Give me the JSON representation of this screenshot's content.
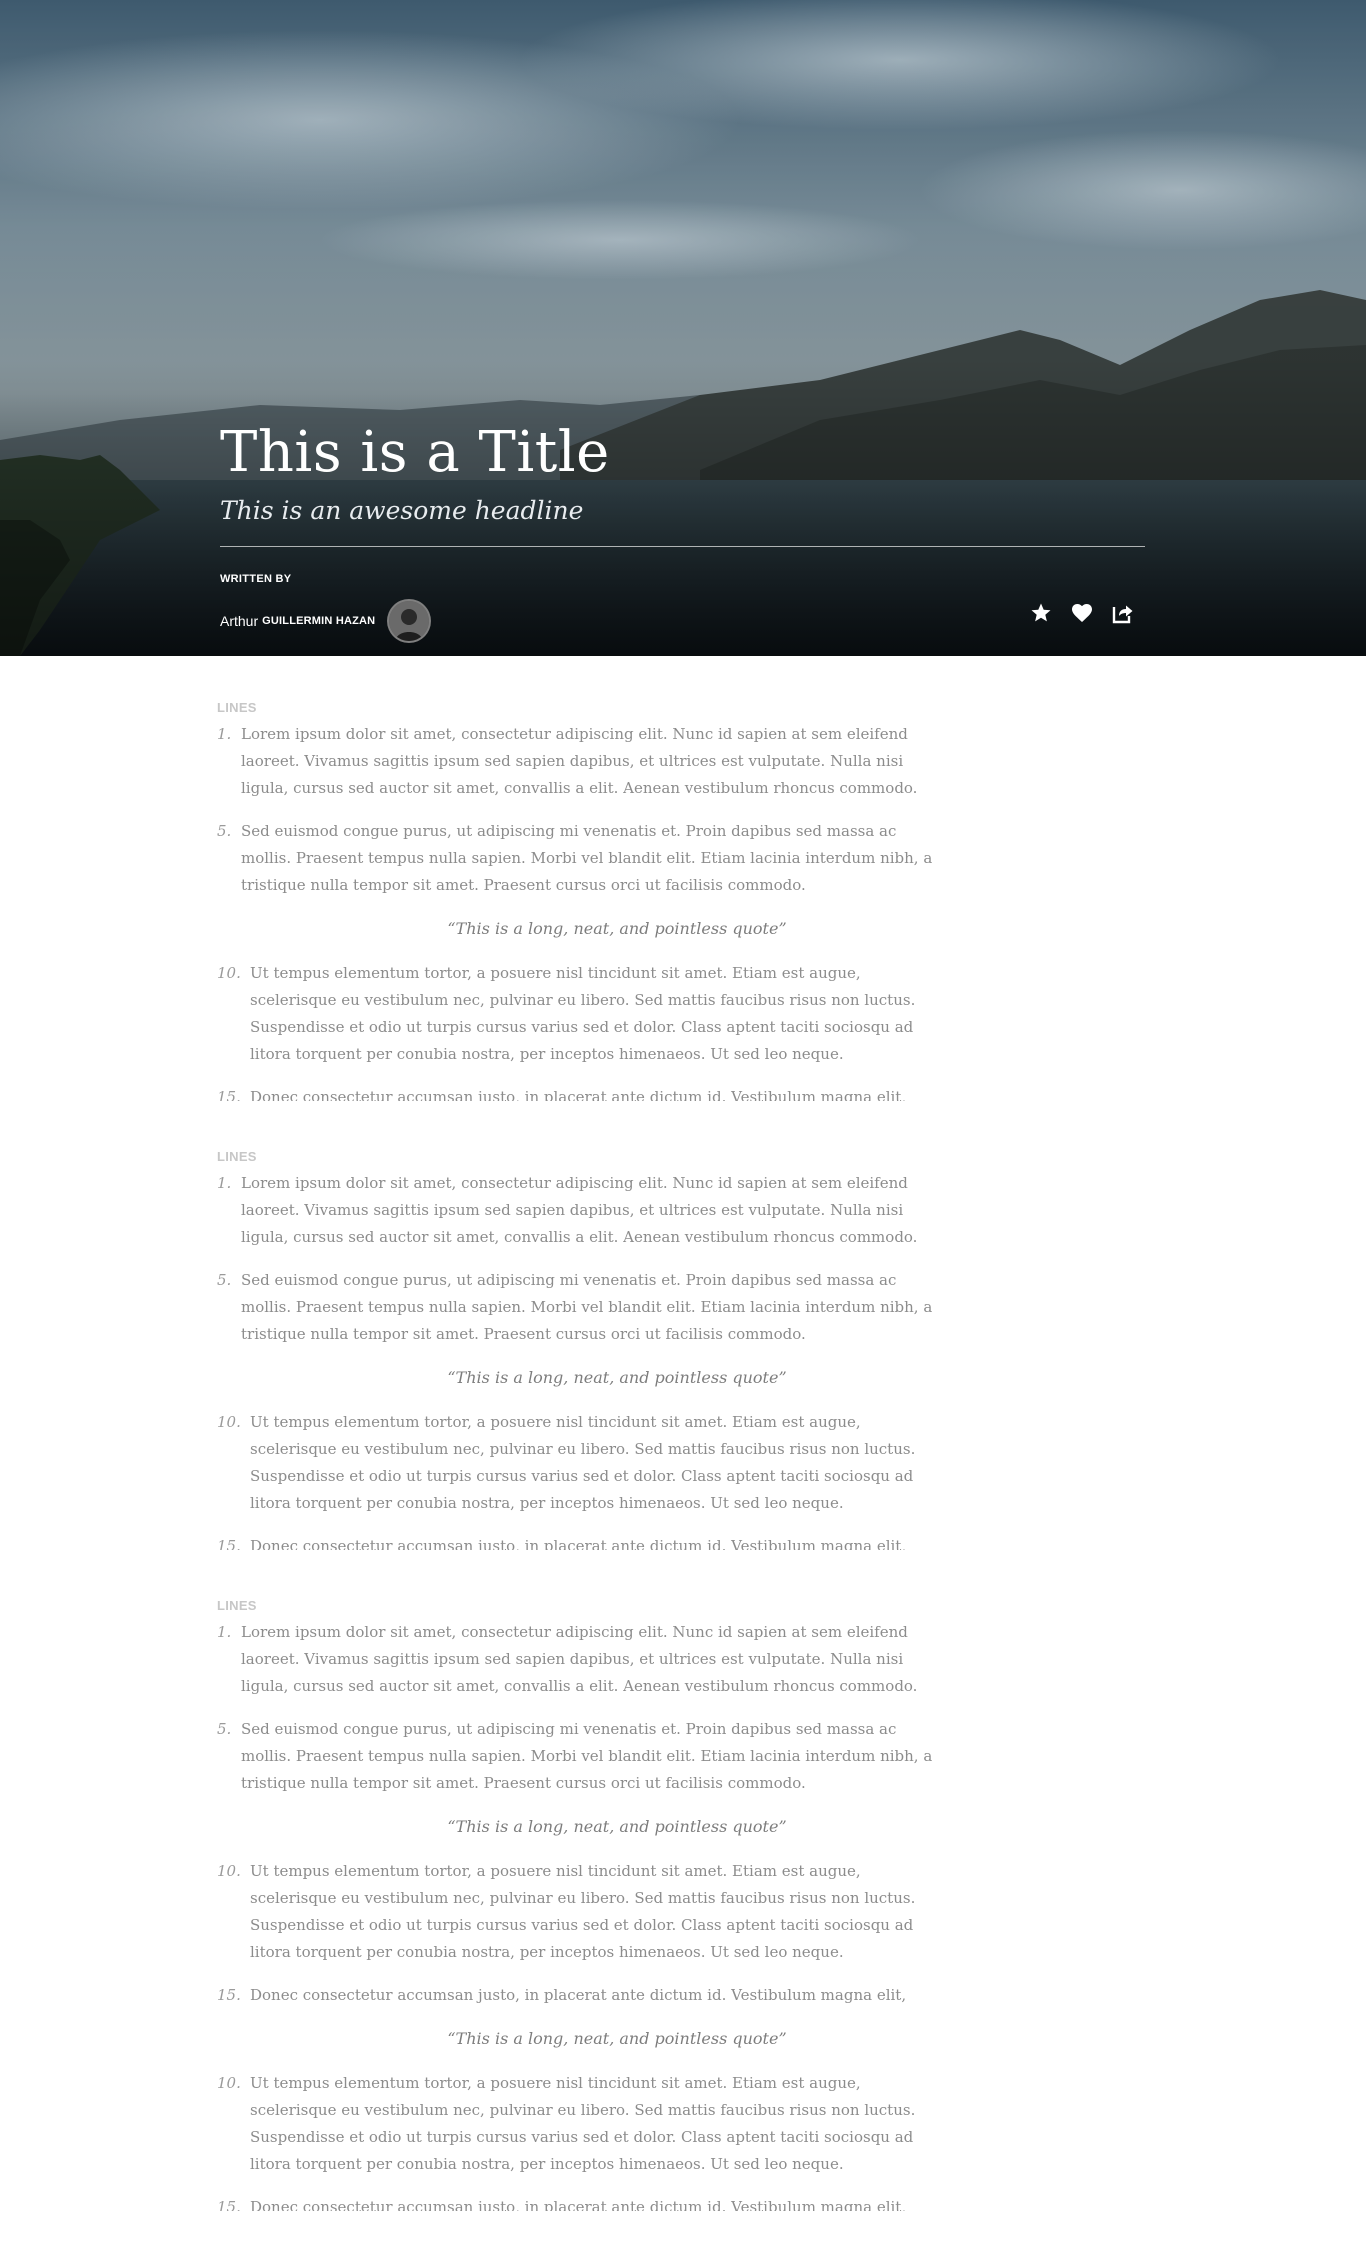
{
  "hero": {
    "title": "This is a Title",
    "headline": "This is an awesome headline",
    "written_by": "WRITTEN BY",
    "author_first": "Arthur",
    "author_last": "GUILLERMIN HAZAN",
    "actions": [
      {
        "name": "star-icon"
      },
      {
        "name": "heart-icon"
      },
      {
        "name": "share-icon"
      }
    ]
  },
  "sections": [
    {
      "label": "LINES",
      "items": [
        {
          "type": "para",
          "num": "1.",
          "text": "Lorem ipsum dolor sit amet, consectetur adipiscing elit. Nunc id sapien at sem eleifend laoreet. Vivamus sagittis ipsum sed sapien dapibus, et ultrices est vulputate. Nulla nisi ligula, cursus sed auctor sit amet, convallis a elit. Aenean vestibulum rhoncus commodo."
        },
        {
          "type": "para",
          "num": "5.",
          "text": "Sed euismod congue purus, ut adipiscing mi venenatis et. Proin dapibus sed massa ac mollis. Praesent tempus nulla sapien. Morbi vel blandit elit. Etiam lacinia interdum nibh, a tristique nulla tempor sit amet. Praesent cursus orci ut facilisis commodo."
        },
        {
          "type": "quote",
          "text": "“This is a long, neat, and pointless quote”"
        },
        {
          "type": "para",
          "num": "10.",
          "text": "Ut tempus elementum tortor, a posuere nisl tincidunt sit amet. Etiam est augue, scelerisque eu vestibulum nec, pulvinar eu libero. Sed mattis faucibus risus non luctus. Suspendisse et odio ut turpis cursus varius sed et dolor. Class aptent taciti sociosqu ad litora torquent per conubia nostra, per inceptos himenaeos. Ut sed leo neque."
        },
        {
          "type": "cut",
          "num": "15.",
          "text": "Donec consectetur accumsan justo, in placerat ante dictum id. Vestibulum magna elit,"
        }
      ]
    },
    {
      "label": "LINES",
      "items": [
        {
          "type": "para",
          "num": "1.",
          "text": "Lorem ipsum dolor sit amet, consectetur adipiscing elit. Nunc id sapien at sem eleifend laoreet. Vivamus sagittis ipsum sed sapien dapibus, et ultrices est vulputate. Nulla nisi ligula, cursus sed auctor sit amet, convallis a elit. Aenean vestibulum rhoncus commodo."
        },
        {
          "type": "para",
          "num": "5.",
          "text": "Sed euismod congue purus, ut adipiscing mi venenatis et. Proin dapibus sed massa ac mollis. Praesent tempus nulla sapien. Morbi vel blandit elit. Etiam lacinia interdum nibh, a tristique nulla tempor sit amet. Praesent cursus orci ut facilisis commodo."
        },
        {
          "type": "quote",
          "text": "“This is a long, neat, and pointless quote”"
        },
        {
          "type": "para",
          "num": "10.",
          "text": "Ut tempus elementum tortor, a posuere nisl tincidunt sit amet. Etiam est augue, scelerisque eu vestibulum nec, pulvinar eu libero. Sed mattis faucibus risus non luctus. Suspendisse et odio ut turpis cursus varius sed et dolor. Class aptent taciti sociosqu ad litora torquent per conubia nostra, per inceptos himenaeos. Ut sed leo neque."
        },
        {
          "type": "cut",
          "num": "15.",
          "text": "Donec consectetur accumsan justo, in placerat ante dictum id. Vestibulum magna elit,"
        }
      ]
    },
    {
      "label": "LINES",
      "items": [
        {
          "type": "para",
          "num": "1.",
          "text": "Lorem ipsum dolor sit amet, consectetur adipiscing elit. Nunc id sapien at sem eleifend laoreet. Vivamus sagittis ipsum sed sapien dapibus, et ultrices est vulputate. Nulla nisi ligula, cursus sed auctor sit amet, convallis a elit. Aenean vestibulum rhoncus commodo."
        },
        {
          "type": "para",
          "num": "5.",
          "text": "Sed euismod congue purus, ut adipiscing mi venenatis et. Proin dapibus sed massa ac mollis. Praesent tempus nulla sapien. Morbi vel blandit elit. Etiam lacinia interdum nibh, a tristique nulla tempor sit amet. Praesent cursus orci ut facilisis commodo."
        },
        {
          "type": "quote",
          "text": "“This is a long, neat, and pointless quote”"
        },
        {
          "type": "para",
          "num": "10.",
          "text": "Ut tempus elementum tortor, a posuere nisl tincidunt sit amet. Etiam est augue, scelerisque eu vestibulum nec, pulvinar eu libero. Sed mattis faucibus risus non luctus. Suspendisse et odio ut turpis cursus varius sed et dolor. Class aptent taciti sociosqu ad litora torquent per conubia nostra, per inceptos himenaeos. Ut sed leo neque."
        },
        {
          "type": "para",
          "num": "15.",
          "text": "Donec consectetur accumsan justo, in placerat ante dictum id. Vestibulum magna elit,"
        },
        {
          "type": "quote",
          "text": "“This is a long, neat, and pointless quote”"
        },
        {
          "type": "para",
          "num": "10.",
          "text": "Ut tempus elementum tortor, a posuere nisl tincidunt sit amet. Etiam est augue, scelerisque eu vestibulum nec, pulvinar eu libero. Sed mattis faucibus risus non luctus. Suspendisse et odio ut turpis cursus varius sed et dolor. Class aptent taciti sociosqu ad litora torquent per conubia nostra, per inceptos himenaeos. Ut sed leo neque."
        },
        {
          "type": "cut",
          "num": "15.",
          "text": "Donec consectetur accumsan justo, in placerat ante dictum id. Vestibulum magna elit,"
        }
      ]
    }
  ]
}
